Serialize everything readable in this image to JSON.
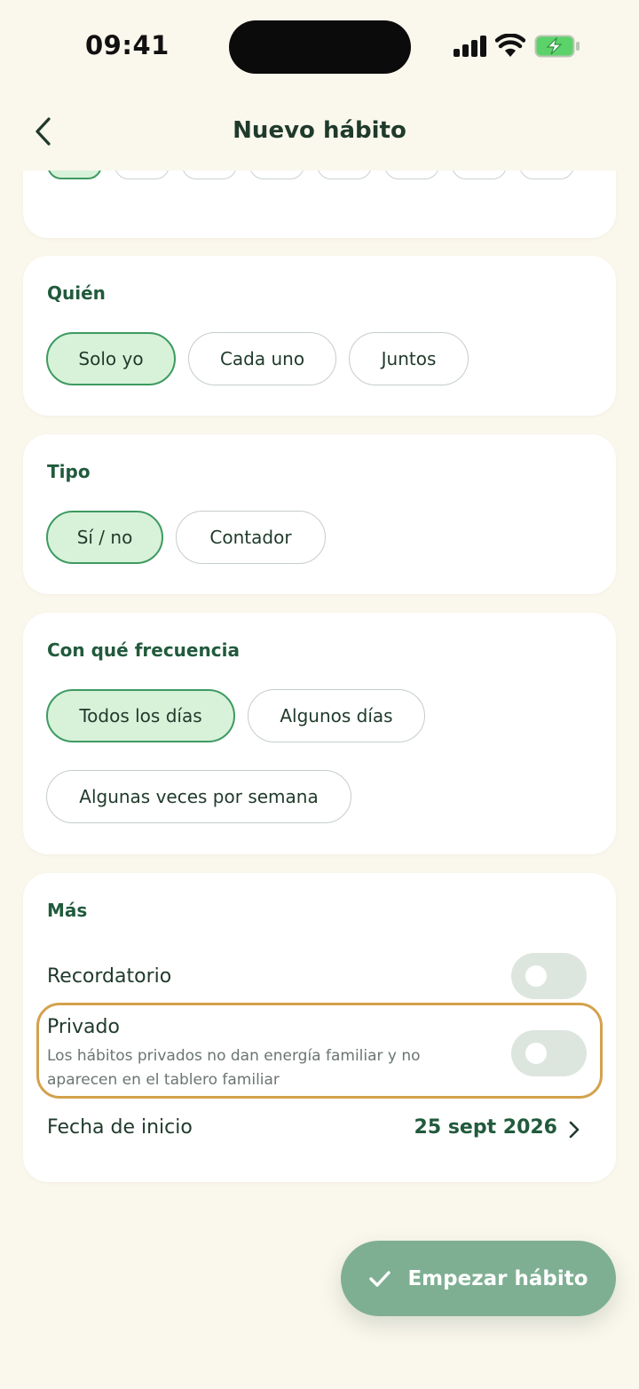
{
  "status_bar": {
    "time": "09:41"
  },
  "header": {
    "title": "Nuevo hábito"
  },
  "icon_picker": {
    "options": [
      {
        "emoji": "✅",
        "name": "check-mark-icon",
        "selected": true
      },
      {
        "emoji": "📚",
        "name": "books-icon",
        "selected": false
      },
      {
        "emoji": "💧",
        "name": "droplet-icon",
        "selected": false
      },
      {
        "emoji": "🏃",
        "name": "runner-icon",
        "selected": false
      },
      {
        "emoji": "🧘",
        "name": "meditation-icon",
        "selected": false
      },
      {
        "emoji": "🦷",
        "name": "tooth-icon",
        "selected": false
      },
      {
        "emoji": "🧹",
        "name": "broom-icon",
        "selected": false
      },
      {
        "emoji": "💛",
        "name": "yellow-heart-icon",
        "selected": false
      }
    ]
  },
  "who": {
    "title": "Quién",
    "options": [
      "Solo yo",
      "Cada uno",
      "Juntos"
    ],
    "selected": "Solo yo"
  },
  "type": {
    "title": "Tipo",
    "options": [
      "Sí / no",
      "Contador"
    ],
    "selected": "Sí / no"
  },
  "frequency": {
    "title": "Con qué frecuencia",
    "options": [
      "Todos los días",
      "Algunos días",
      "Algunas veces por semana"
    ],
    "selected": "Todos los días"
  },
  "more": {
    "title": "Más",
    "reminder": {
      "label": "Recordatorio",
      "on": false
    },
    "private": {
      "label": "Privado",
      "description": "Los hábitos privados no dan energía familiar y no aparecen en el tablero familiar",
      "on": false
    },
    "start_date": {
      "label": "Fecha de inicio",
      "value": "25 sept 2026"
    }
  },
  "cta": {
    "label": "Empezar hábito"
  },
  "colors": {
    "background": "#faf7ec",
    "card": "#ffffff",
    "accent": "#215a3c",
    "chip_selected": "#d7f2d9",
    "chip_selected_border": "#3e9a62",
    "cta": "#7faf93",
    "highlight": "#d4a14c"
  }
}
